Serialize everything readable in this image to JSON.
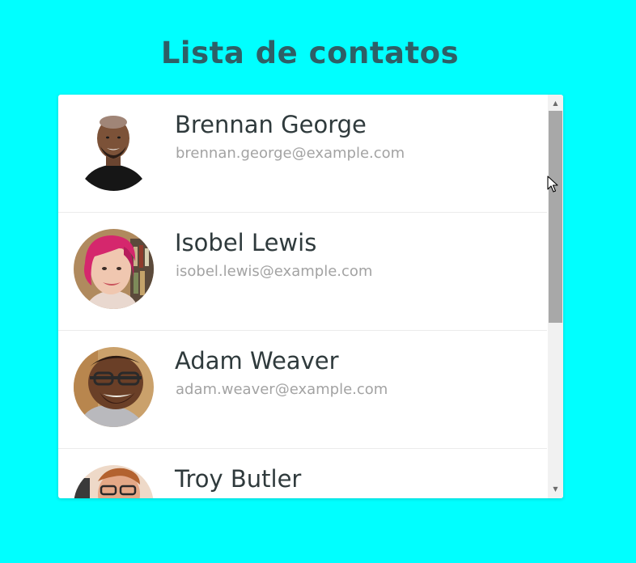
{
  "page": {
    "title": "Lista de contatos"
  },
  "contacts": [
    {
      "name": "Brennan George",
      "email": "brennan.george@example.com"
    },
    {
      "name": "Isobel Lewis",
      "email": "isobel.lewis@example.com"
    },
    {
      "name": "Adam Weaver",
      "email": "adam.weaver@example.com"
    },
    {
      "name": "Troy Butler",
      "email": ""
    }
  ],
  "scrollbar": {
    "up_arrow": "▲",
    "down_arrow": "▼",
    "position_fraction": 0.0
  },
  "colors": {
    "background": "#00ffff",
    "title": "#2e5f66",
    "name": "#2f3a3c",
    "email": "#a3a3a3"
  }
}
